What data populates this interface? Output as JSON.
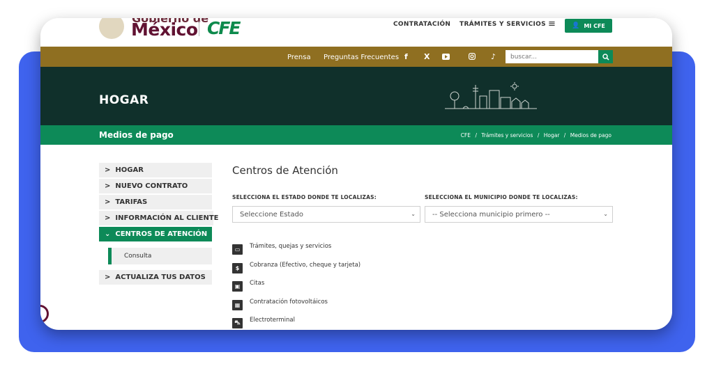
{
  "header": {
    "logo_top": "Gobierno de",
    "logo_main": "México",
    "logo_cfe": "CFE",
    "nav": [
      "CONTRATACIÓN",
      "TRÁMITES Y SERVICIOS"
    ],
    "menu_icon": "hamburger-icon",
    "account_button": "MI CFE"
  },
  "goldbar": {
    "links": [
      "Prensa",
      "Preguntas Frecuentes"
    ],
    "social_icons": [
      "facebook-icon",
      "x-icon",
      "youtube-icon",
      "instagram-icon",
      "tiktok-icon"
    ],
    "search_placeholder": "buscar...",
    "search_icon": "search-icon"
  },
  "hero": {
    "title": "HOGAR"
  },
  "subheader": {
    "title": "Medios de pago",
    "breadcrumb": [
      "CFE",
      "Trámites y servicios",
      "Hogar",
      "Medios de pago"
    ],
    "separator": "/"
  },
  "sidebar": {
    "items": [
      {
        "label": "HOGAR",
        "active": false
      },
      {
        "label": "NUEVO CONTRATO",
        "active": false
      },
      {
        "label": "TARIFAS",
        "active": false
      },
      {
        "label": "INFORMACIÓN AL CLIENTE",
        "active": false
      },
      {
        "label": "CENTROS DE ATENCIÓN",
        "active": true
      }
    ],
    "subitem": "Consulta",
    "last_item": "ACTUALIZA TUS DATOS"
  },
  "main": {
    "title": "Centros de Atención",
    "estado_label": "SELECCIONA EL ESTADO DONDE TE LOCALIZAS:",
    "estado_value": "Seleccione Estado",
    "municipio_label": "SELECCIONA EL MUNICIPIO DONDE TE LOCALIZAS:",
    "municipio_value": "-- Selecciona municipio primero --",
    "services": [
      {
        "icon": "chat-icon",
        "label": "Trámites, quejas y servicios"
      },
      {
        "icon": "dollar-icon",
        "label": "Cobranza (Efectivo, cheque y tarjeta)"
      },
      {
        "icon": "calendar-icon",
        "label": "Citas"
      },
      {
        "icon": "solar-panel-icon",
        "label": "Contratación fotovoltáicos"
      },
      {
        "icon": "car-icon",
        "label": "Electroterminal"
      }
    ]
  },
  "colors": {
    "accent_blue": "#3f63ee",
    "gold": "#8f6f21",
    "dark_green": "#10302b",
    "green": "#0d8a58",
    "wine": "#611232"
  }
}
